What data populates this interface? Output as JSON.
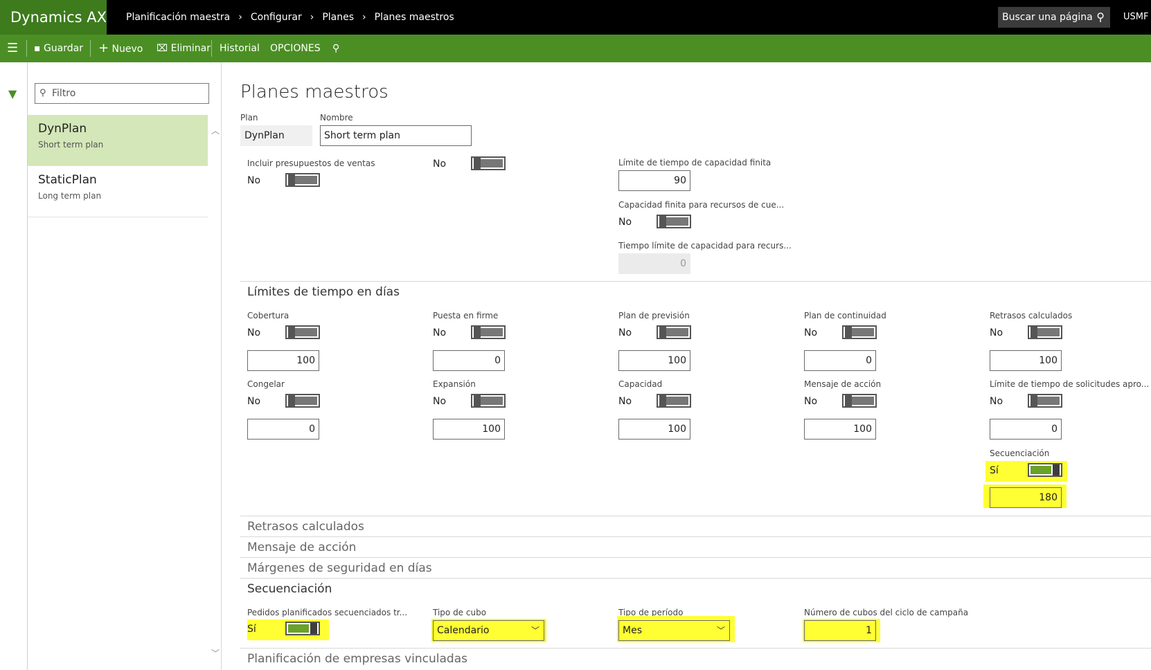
{
  "brand": "Dynamics AX",
  "breadcrumb": [
    "Planificación maestra",
    "Configurar",
    "Planes",
    "Planes maestros"
  ],
  "search": {
    "label": "Buscar una página"
  },
  "company": "USMF",
  "toolbar": {
    "save": "Guardar",
    "new": "Nuevo",
    "delete": "Eliminar",
    "history": "Historial",
    "options": "OPCIONES"
  },
  "list": {
    "filter_placeholder": "Filtro",
    "items": [
      {
        "name": "DynPlan",
        "desc": "Short term plan"
      },
      {
        "name": "StaticPlan",
        "desc": "Long term plan"
      }
    ]
  },
  "main": {
    "title": "Planes maestros",
    "plan_label": "Plan",
    "plan_value": "DynPlan",
    "name_label": "Nombre",
    "name_value": "Short term plan",
    "include_sales_label": "Incluir presupuestos de ventas",
    "include_sales_value": "No",
    "unlabeled_toggle_value": "No",
    "finite_cap_limit_label": "Límite de tiempo de capacidad finita",
    "finite_cap_limit_value": "90",
    "finite_cap_bottleneck_label": "Capacidad finita para recursos de cue...",
    "finite_cap_bottleneck_value": "No",
    "bottleneck_time_label": "Tiempo límite de capacidad para recurs...",
    "bottleneck_time_value": "0"
  },
  "time_fences": {
    "header": "Límites de tiempo en días",
    "row1": [
      {
        "label": "Cobertura",
        "toggle": "No",
        "value": "100"
      },
      {
        "label": "Puesta en firme",
        "toggle": "No",
        "value": "0"
      },
      {
        "label": "Plan de previsión",
        "toggle": "No",
        "value": "100"
      },
      {
        "label": "Plan de continuidad",
        "toggle": "No",
        "value": "0"
      },
      {
        "label": "Retrasos calculados",
        "toggle": "No",
        "value": "100"
      }
    ],
    "row2": [
      {
        "label": "Congelar",
        "toggle": "No",
        "value": "0"
      },
      {
        "label": "Expansión",
        "toggle": "No",
        "value": "100"
      },
      {
        "label": "Capacidad",
        "toggle": "No",
        "value": "100"
      },
      {
        "label": "Mensaje de acción",
        "toggle": "No",
        "value": "100"
      },
      {
        "label": "Límite de tiempo de solicitudes apro...",
        "toggle": "No",
        "value": "0"
      }
    ],
    "sequencing": {
      "label": "Secuenciación",
      "toggle": "Sí",
      "value": "180"
    }
  },
  "sections": {
    "delays": "Retrasos calculados",
    "action": "Mensaje de acción",
    "safety": "Márgenes de seguridad en días",
    "sequencing": "Secuenciación",
    "intercompany": "Planificación de empresas vinculadas"
  },
  "sequencing_section": {
    "planned_label": "Pedidos planificados secuenciados tr...",
    "planned_value": "Sí",
    "bucket_type_label": "Tipo de cubo",
    "bucket_type_value": "Calendario",
    "period_type_label": "Tipo de período",
    "period_type_value": "Mes",
    "buckets_label": "Número de cubos del ciclo de campaña",
    "buckets_value": "1"
  },
  "colors": {
    "brand": "#3d7b1d",
    "actionbar": "#4b8f24",
    "selected": "#d4e7b8",
    "highlight": "#ffff33"
  }
}
